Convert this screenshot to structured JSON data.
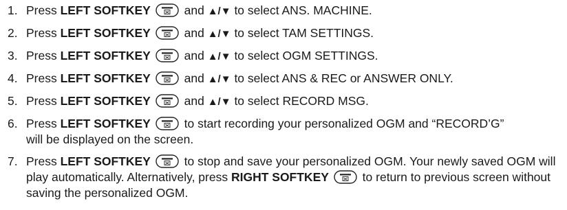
{
  "steps": [
    {
      "number": "1.",
      "press": "Press",
      "key": "LEFT SOFTKEY",
      "and": "and",
      "arrows": "▲/▼",
      "rest": "to select ANS. MACHINE."
    },
    {
      "number": "2.",
      "press": "Press",
      "key": "LEFT SOFTKEY",
      "and": "and",
      "arrows": "▲/▼",
      "rest": "to select TAM SETTINGS."
    },
    {
      "number": "3.",
      "press": "Press",
      "key": "LEFT SOFTKEY",
      "and": "and",
      "arrows": "▲/▼",
      "rest": "to select OGM SETTINGS."
    },
    {
      "number": "4.",
      "press": "Press",
      "key": "LEFT SOFTKEY",
      "and": "and",
      "arrows": "▲/▼",
      "rest": "to select ANS & REC or ANSWER ONLY."
    },
    {
      "number": "5.",
      "press": "Press",
      "key": "LEFT SOFTKEY",
      "and": "and",
      "arrows": "▲/▼",
      "rest": "to select RECORD MSG."
    },
    {
      "number": "6.",
      "press": "Press",
      "key": "LEFT SOFTKEY",
      "rest": "to start recording your personalized OGM and “RECORD’G” will be displayed on the screen."
    },
    {
      "number": "7.",
      "press": "Press",
      "key": "LEFT SOFTKEY",
      "rest": "to stop and save your personalized OGM. Your newly saved OGM will play automatically. Alternatively, press",
      "key2": "RIGHT SOFTKEY",
      "rest2": "to return to previous screen without saving the personalized OGM."
    }
  ],
  "icons": {
    "softkey": "softkey-button-icon"
  }
}
